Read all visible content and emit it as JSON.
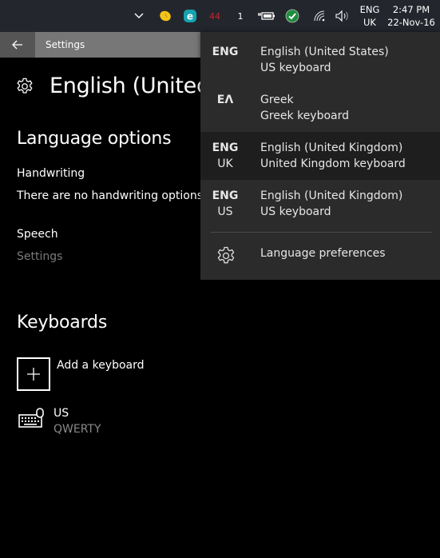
{
  "taskbar": {
    "icons": [
      {
        "name": "show-hidden-icons",
        "glyph": "chevron-up-icon"
      },
      {
        "name": "lemon-app-icon",
        "glyph": "lemon-icon"
      },
      {
        "name": "eset-icon",
        "glyph": "e"
      },
      {
        "name": "red-counter",
        "text": "44",
        "color": "#c1272d"
      },
      {
        "name": "white-counter",
        "text": "1"
      },
      {
        "name": "battery-icon",
        "glyph": "battery-plugged-icon"
      },
      {
        "name": "security-check-icon",
        "glyph": "check-icon",
        "color": "#1e8e3e"
      },
      {
        "name": "wifi-icon",
        "glyph": "wifi-icon"
      },
      {
        "name": "volume-icon",
        "glyph": "speaker-icon"
      }
    ],
    "input_indicator": {
      "line1": "ENG",
      "line2": "UK"
    },
    "clock": {
      "time": "2:47 PM",
      "date": "22-Nov-16"
    }
  },
  "window": {
    "title": "Settings",
    "back_icon": "back-arrow-icon"
  },
  "page": {
    "title": "English (United Kingdom)",
    "title_visible": "English (United",
    "language_options_heading": "Language options",
    "handwriting_label": "Handwriting",
    "handwriting_text": "There are no handwriting options for this language",
    "handwriting_text_visible": "There are no handwriting options f",
    "speech_label": "Speech",
    "speech_settings_link": "Settings",
    "keyboards_heading": "Keyboards",
    "add_keyboard_label": "Add a keyboard",
    "keyboards": [
      {
        "name": "US",
        "layout": "QWERTY"
      }
    ]
  },
  "flyout": {
    "languages": [
      {
        "code1": "ENG",
        "code2": "",
        "language": "English (United States)",
        "keyboard": "US keyboard",
        "selected": false
      },
      {
        "code1": "ΕΛ",
        "code2": "",
        "language": "Greek",
        "keyboard": "Greek keyboard",
        "selected": false
      },
      {
        "code1": "ENG",
        "code2": "UK",
        "language": "English (United Kingdom)",
        "keyboard": "United Kingdom keyboard",
        "selected": true
      },
      {
        "code1": "ENG",
        "code2": "US",
        "language": "English (United Kingdom)",
        "keyboard": "US keyboard",
        "selected": false
      }
    ],
    "preferences_label": "Language preferences"
  },
  "colors": {
    "taskbar_bg": "#23272d",
    "titlebar_bg": "#777777",
    "back_button_bg": "#555555",
    "flyout_bg": "#2b2b2b",
    "flyout_selected_bg": "#1e1e1e",
    "muted_text": "#7a7a7a"
  }
}
